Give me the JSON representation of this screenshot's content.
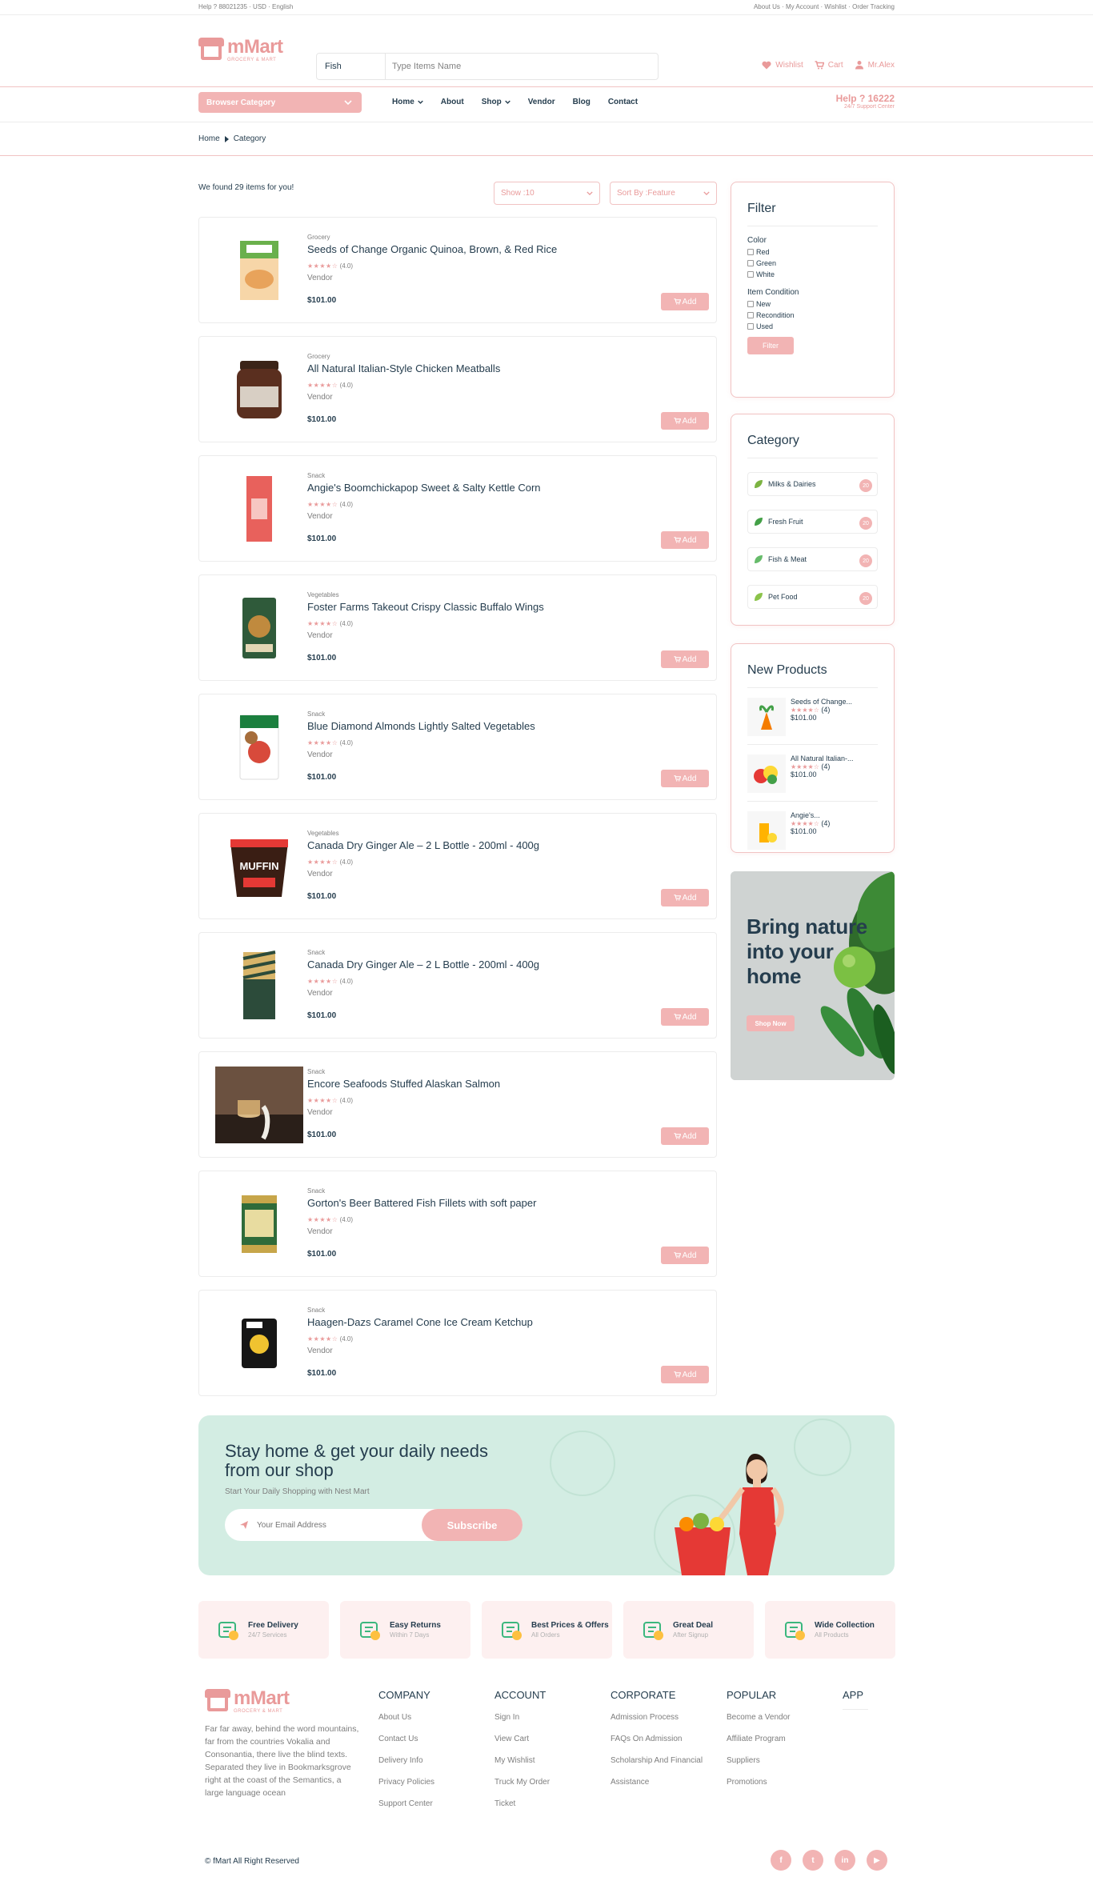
{
  "topbar": {
    "left": "Help ? 88021235 · USD · English",
    "right": "About Us · My Account · Wishlist · Order Tracking"
  },
  "logo": {
    "name": "mMart",
    "tagline": "GROCERY & MART"
  },
  "search": {
    "category": "Fish",
    "placeholder": "Type Items Name"
  },
  "header": {
    "wishlist": "Wishlist",
    "cart": "Cart",
    "user": "Mr.Alex"
  },
  "nav": {
    "browse": "Browser Category",
    "menu": [
      "Home",
      "About",
      "Shop",
      "Vendor",
      "Blog",
      "Contact"
    ],
    "help_number": "Help ? 16222",
    "help_sub": "24/7 Support Center"
  },
  "breadcrumb": {
    "home": "Home",
    "current": "Category"
  },
  "listing": {
    "found": "We found 29 items for you!",
    "show": "Show :10",
    "sort": "Sort By :Feature",
    "add_label": "Add",
    "vendor_label": "Vendor",
    "rating_stars": "★★★★☆",
    "rating": "(4.0)"
  },
  "products": [
    {
      "category": "Grocery",
      "title": "Seeds of Change Organic Quinoa, Brown, & Red Rice",
      "price": "$101.00"
    },
    {
      "category": "Grocery",
      "title": "All Natural Italian-Style Chicken Meatballs",
      "price": "$101.00"
    },
    {
      "category": "Snack",
      "title": "Angie's Boomchickapop Sweet & Salty Kettle Corn",
      "price": "$101.00"
    },
    {
      "category": "Vegetables",
      "title": "Foster Farms Takeout Crispy Classic Buffalo Wings",
      "price": "$101.00"
    },
    {
      "category": "Snack",
      "title": "Blue Diamond Almonds Lightly Salted Vegetables",
      "price": "$101.00"
    },
    {
      "category": "Vegetables",
      "title": "Canada Dry Ginger Ale – 2 L Bottle - 200ml - 400g",
      "price": "$101.00"
    },
    {
      "category": "Snack",
      "title": "Canada Dry Ginger Ale – 2 L Bottle - 200ml - 400g",
      "price": "$101.00"
    },
    {
      "category": "Snack",
      "title": "Encore Seafoods Stuffed Alaskan Salmon",
      "price": "$101.00"
    },
    {
      "category": "Snack",
      "title": "Gorton's Beer Battered Fish Fillets with soft paper",
      "price": "$101.00"
    },
    {
      "category": "Snack",
      "title": "Haagen-Dazs Caramel Cone Ice Cream Ketchup",
      "price": "$101.00"
    }
  ],
  "filter": {
    "title": "Filter",
    "color_label": "Color",
    "colors": [
      "Red",
      "Green",
      "White"
    ],
    "condition_label": "Item Condition",
    "conditions": [
      "New",
      "Recondition",
      "Used"
    ],
    "button": "Filter"
  },
  "category_panel": {
    "title": "Category",
    "items": [
      {
        "name": "Milks & Dairies",
        "count": "20"
      },
      {
        "name": "Fresh Fruit",
        "count": "20"
      },
      {
        "name": "Fish & Meat",
        "count": "20"
      },
      {
        "name": "Pet Food",
        "count": "20"
      }
    ]
  },
  "new_products": {
    "title": "New Products",
    "items": [
      {
        "name": "Seeds of Change...",
        "stars": "★★★★☆",
        "rating": "(4)",
        "price": "$101.00"
      },
      {
        "name": "All Natural Italian-...",
        "stars": "★★★★☆",
        "rating": "(4)",
        "price": "$101.00"
      },
      {
        "name": "Angie's...",
        "stars": "★★★★☆",
        "rating": "(4)",
        "price": "$101.00"
      }
    ]
  },
  "banner": {
    "line1": "Bring nature",
    "line2": "into your",
    "line3": "home",
    "button": "Shop Now"
  },
  "newsletter": {
    "line1": "Stay home & get your daily needs",
    "line2": "from our shop",
    "sub": "Start Your Daily Shopping with Nest Mart",
    "placeholder": "Your Email Address",
    "button": "Subscribe"
  },
  "features": [
    {
      "title": "Free Delivery",
      "sub": "24/7 Services"
    },
    {
      "title": "Easy Returns",
      "sub": "Within 7 Days"
    },
    {
      "title": "Best Prices & Offers",
      "sub": "All Orders"
    },
    {
      "title": "Great Deal",
      "sub": "After Signup"
    },
    {
      "title": "Wide Collection",
      "sub": "All Products"
    }
  ],
  "footer": {
    "description": "Far far away, behind the word mountains, far from the countries Vokalia and Consonantia, there live the blind texts. Separated they live in Bookmarksgrove right at the coast of the Semantics, a large language ocean",
    "columns": [
      {
        "title": "COMPANY",
        "links": [
          "About Us",
          "Contact Us",
          "Delivery Info",
          "Privacy Policies",
          "Support Center"
        ]
      },
      {
        "title": "ACCOUNT",
        "links": [
          "Sign In",
          "View Cart",
          "My Wishlist",
          "Truck My Order",
          "Ticket"
        ]
      },
      {
        "title": "CORPORATE",
        "links": [
          "Admission Process",
          "FAQs On Admission",
          "Scholarship And Financial",
          "Assistance"
        ]
      },
      {
        "title": "POPULAR",
        "links": [
          "Become a Vendor",
          "Affiliate Program",
          "Suppliers",
          "Promotions"
        ]
      },
      {
        "title": "APP",
        "links": []
      }
    ],
    "copyright": "© fMart All Right Reserved",
    "social": [
      "f",
      "t",
      "in",
      "▶"
    ]
  },
  "colors": {
    "accent": "#f2b4b4",
    "accent_text": "#e99a9a",
    "newsletter_bg": "#d3ede3",
    "text": "#253d4e"
  }
}
